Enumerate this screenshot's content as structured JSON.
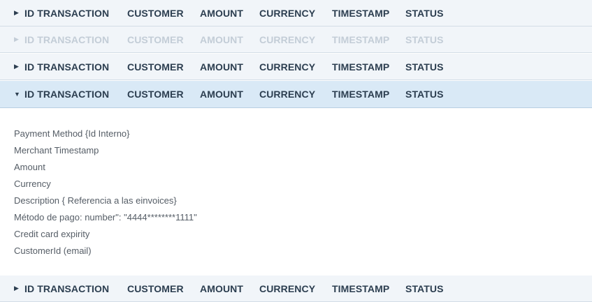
{
  "columns": [
    "ID TRANSACTION",
    "CUSTOMER",
    "AMOUNT",
    "CURRENCY",
    "TIMESTAMP",
    "STATUS"
  ],
  "rows": [
    {
      "arrow": "▶",
      "state": "collapsed"
    },
    {
      "arrow": "▶",
      "state": "disabled"
    },
    {
      "arrow": "▶",
      "state": "collapsed"
    },
    {
      "arrow": "▼",
      "state": "expanded"
    },
    {
      "arrow": "▶",
      "state": "collapsed"
    }
  ],
  "details": [
    "Payment Method {Id Interno}",
    "Merchant Timestamp",
    "Amount",
    "Currency",
    "Description { Referencia a las einvoices}",
    "Método de pago: number\": \"4444********1111\"",
    "Credit card expirity",
    "CustomerId (email)"
  ]
}
